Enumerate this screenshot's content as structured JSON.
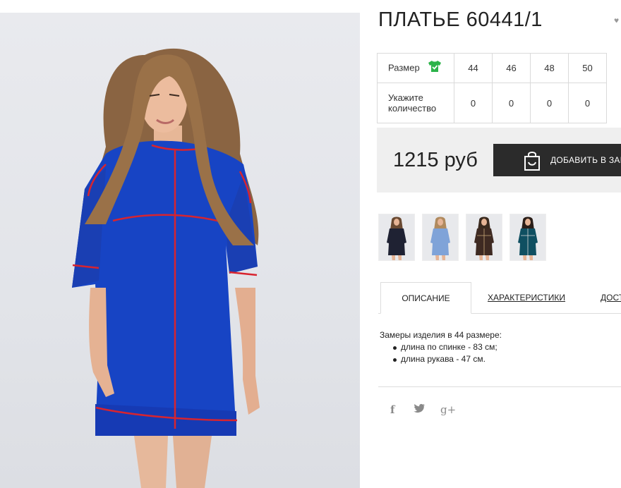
{
  "product": {
    "title": "ПЛАТЬЕ 60441/1",
    "price": "1215 руб",
    "add_to_cart": "ДОБАВИТЬ В ЗАКАЗ",
    "photo_icon": "model-in-blue-dress-photo"
  },
  "size_table": {
    "size_label": "Размер",
    "size_icon": "t-shirt-check-icon",
    "qty_label": "Укажите количество",
    "sizes": [
      "44",
      "46",
      "48",
      "50"
    ],
    "quantities": [
      "0",
      "0",
      "0",
      "0"
    ]
  },
  "thumbnails": [
    {
      "color_name": "black-dress",
      "color": "#1f2233"
    },
    {
      "color_name": "light-blue-dress",
      "color": "#7fa3d8"
    },
    {
      "color_name": "brown-dress",
      "color": "#3e2a22"
    },
    {
      "color_name": "teal-dress",
      "color": "#0f4f61"
    }
  ],
  "tabs": [
    "ОПИСАНИЕ",
    "ХАРАКТЕРИСТИКИ",
    "ДОСТАВКА"
  ],
  "description": {
    "intro": "Замеры изделия в 44 размере:",
    "items": [
      "длина по спинке - 83 см;",
      "длина рукава - 47 см."
    ]
  },
  "social": {
    "facebook": "f",
    "twitter_icon": "twitter-bird-icon",
    "googleplus": "g+"
  },
  "colors": {
    "accent_green": "#2db34a",
    "button_dark": "#2b2b2b",
    "dress_blue": "#1744c4",
    "piping_red": "#d8242f"
  }
}
